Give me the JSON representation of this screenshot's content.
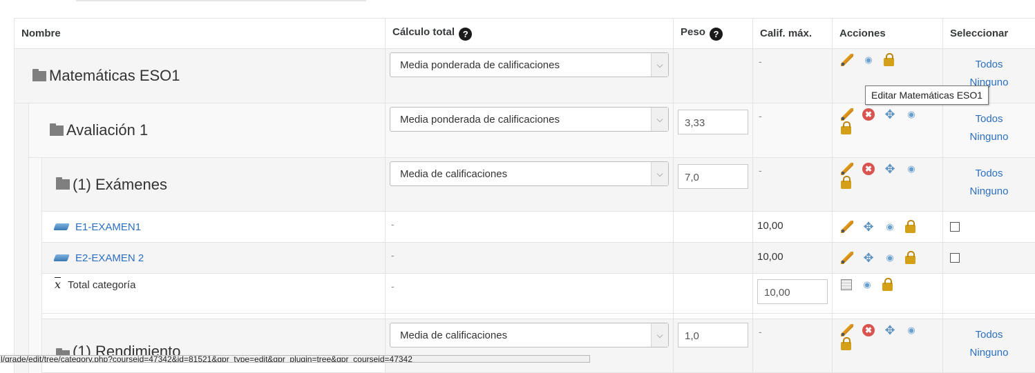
{
  "headers": {
    "name": "Nombre",
    "calc_total": "Cálculo total",
    "weight": "Peso",
    "max_grade": "Calif. máx.",
    "actions": "Acciones",
    "select": "Seleccionar",
    "help_symbol": "?"
  },
  "rows": [
    {
      "kind": "category",
      "name": "Matemáticas ESO1",
      "calc": "Media ponderada de calificaciones",
      "weight": "",
      "max": "-",
      "links": [
        "Todos",
        "Ninguno"
      ]
    },
    {
      "kind": "category",
      "name": "Avaliación 1",
      "calc": "Media ponderada de calificaciones",
      "weight": "3,33",
      "max": "-",
      "links": [
        "Todos",
        "Ninguno"
      ]
    },
    {
      "kind": "category",
      "name": "(1) Exámenes",
      "calc": "Media de calificaciones",
      "weight": "7,0",
      "max": "-",
      "links": [
        "Todos",
        "Ninguno"
      ]
    },
    {
      "kind": "item",
      "name": "E1-EXAMEN1",
      "calc": "-",
      "max": "10,00"
    },
    {
      "kind": "item",
      "name": "E2-EXAMEN 2",
      "calc": "-",
      "max": "10,00"
    },
    {
      "kind": "total",
      "name": "Total categoría",
      "calc": "-",
      "max": "10,00"
    },
    {
      "kind": "category",
      "name": "(1) Rendimiento",
      "calc": "Media de calificaciones",
      "weight": "1,0",
      "max": "-",
      "links": [
        "Todos",
        "Ninguno"
      ]
    }
  ],
  "icons": {
    "delete_glyph": "✖",
    "move_glyph": "✥",
    "eye_glyph": "◉",
    "dropdown_glyph": "⌵"
  },
  "tooltip": "Editar  Matemáticas ESO1",
  "status_url": "l/grade/edit/tree/category.php?courseid=47342&id=81521&gpr_type=edit&gpr_plugin=tree&gpr_courseid=47342"
}
